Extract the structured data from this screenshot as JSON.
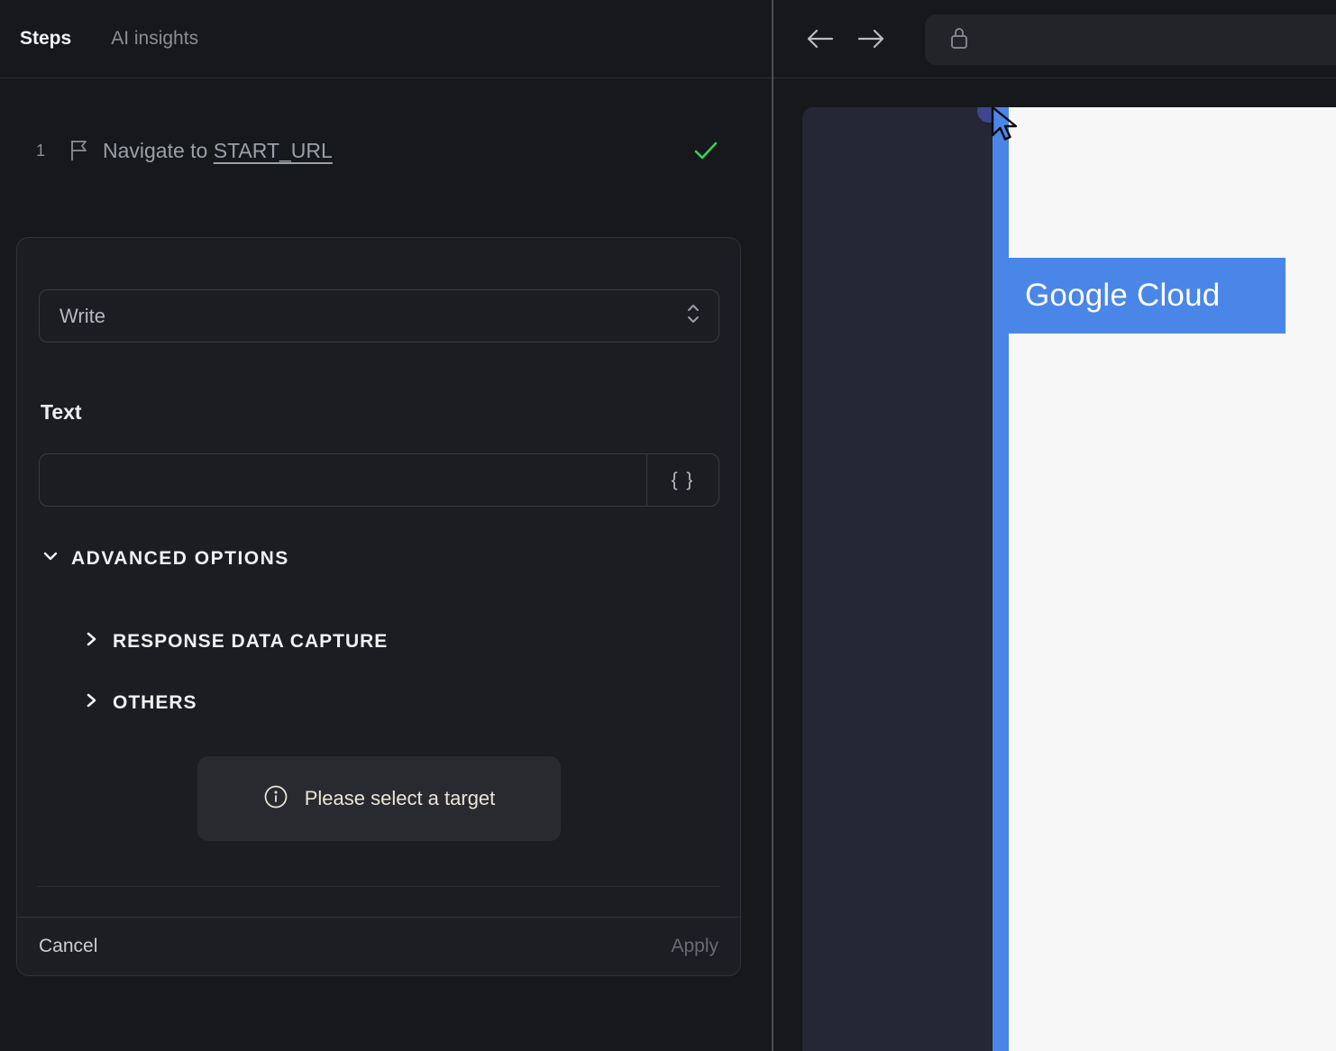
{
  "left_panel": {
    "tabs": [
      {
        "label": "Steps"
      },
      {
        "label": "AI insights"
      }
    ],
    "step": {
      "index": "1",
      "text": "Navigate to ",
      "link": "START_URL",
      "status": "success"
    },
    "editor": {
      "action_select": {
        "value": "Write"
      },
      "text_field": {
        "label": "Text",
        "value": "",
        "placeholder": ""
      },
      "variable_button_label": "{ }",
      "advanced_options_label": "ADVANCED OPTIONS",
      "sections": [
        {
          "label": "RESPONSE DATA CAPTURE"
        },
        {
          "label": "OTHERS"
        }
      ],
      "notice_text": "Please select a target",
      "cancel_label": "Cancel",
      "apply_label": "Apply"
    }
  },
  "browser": {
    "address_bar": {
      "value": ""
    },
    "page": {
      "badge_text": "Google Cloud"
    }
  },
  "colors": {
    "accent_blue": "#4a86e8",
    "success_green": "#33d45b",
    "notice_cream": "#ece5d6",
    "panel_dark": "#17181c",
    "navy_panel": "#252734"
  }
}
